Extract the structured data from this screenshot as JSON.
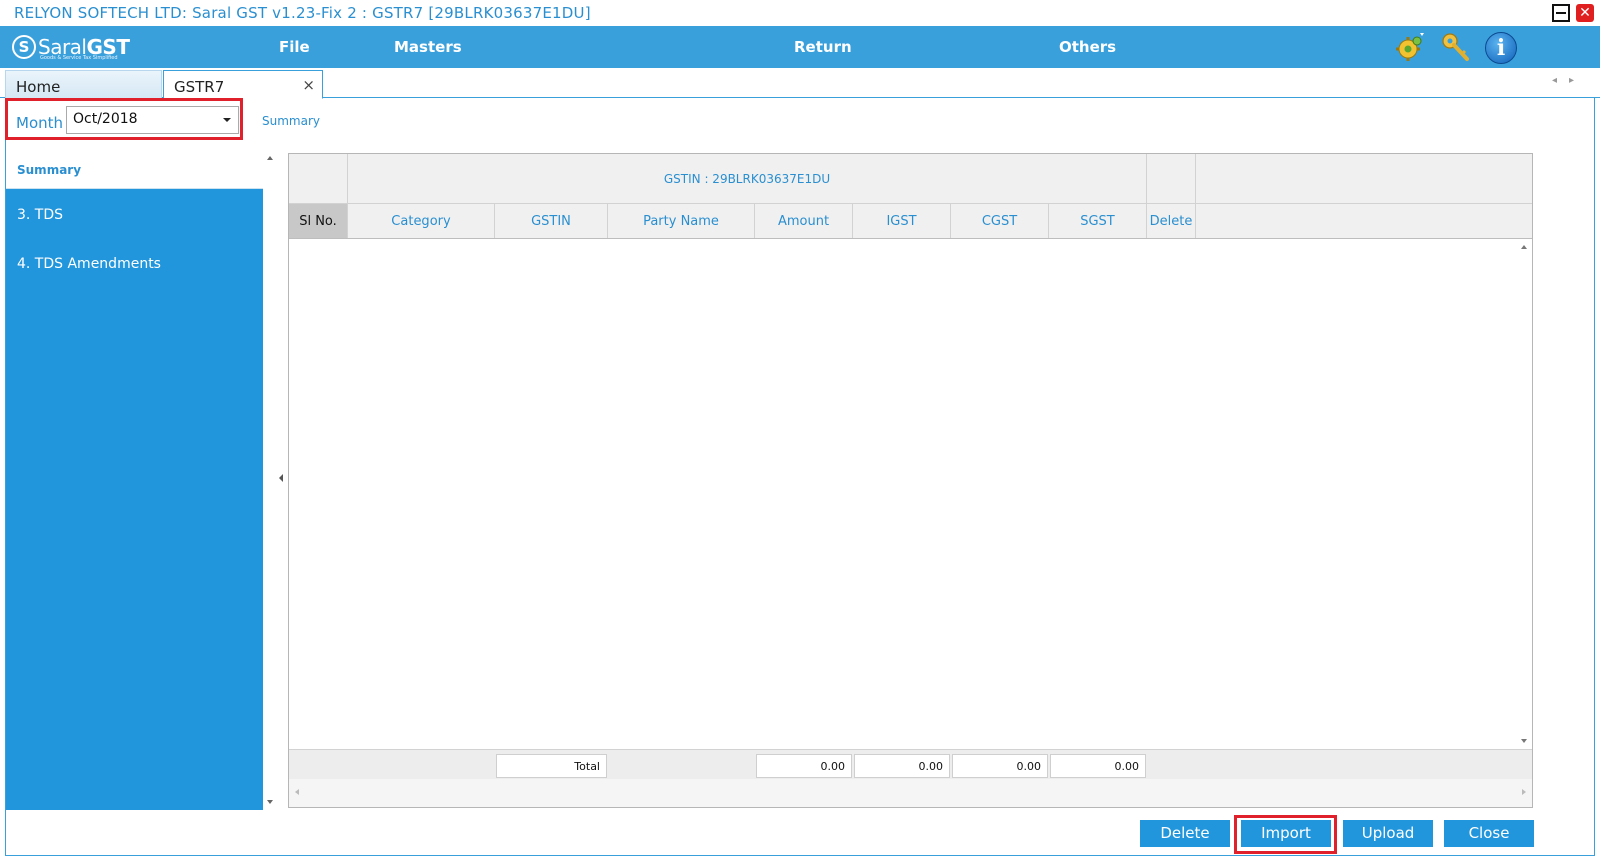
{
  "window": {
    "title": "RELYON SOFTECH LTD: Saral GST v1.23-Fix 2 : GSTR7 [29BLRK03637E1DU]",
    "minimize_glyph": "",
    "close_glyph": "✕"
  },
  "menubar": {
    "logo_prefix": "Saral",
    "logo_bold": "GST",
    "logo_tagline": "Goods & Service Tax Simplified",
    "items": [
      "File",
      "Masters",
      "Return",
      "Others"
    ],
    "icons": [
      "settings-gear-icon",
      "key-icon",
      "info-icon"
    ]
  },
  "tabs": {
    "home": "Home",
    "gstr7": "GSTR7",
    "close_glyph": "×",
    "arrows": "◂▸"
  },
  "filter": {
    "month_label": "Month",
    "month_value": "Oct/2018"
  },
  "breadcrumb": "Summary",
  "sidebar": {
    "items": [
      "Summary",
      "3. TDS",
      "4. TDS Amendments"
    ],
    "selected": "Summary"
  },
  "grid": {
    "gstin_header": "GSTIN : 29BLRK03637E1DU",
    "columns": [
      "Sl No.",
      "Category",
      "GSTIN",
      "Party Name",
      "Amount",
      "IGST",
      "CGST",
      "SGST",
      "Delete"
    ],
    "rows": [],
    "footer": {
      "total_label": "Total",
      "amount": "0.00",
      "igst": "0.00",
      "cgst": "0.00",
      "sgst": "0.00"
    }
  },
  "buttons": {
    "delete": "Delete",
    "import": "Import",
    "upload": "Upload",
    "close": "Close"
  },
  "colors": {
    "accent": "#3aa0dc",
    "sidebar": "#2196dc",
    "highlight": "#e0202a"
  }
}
